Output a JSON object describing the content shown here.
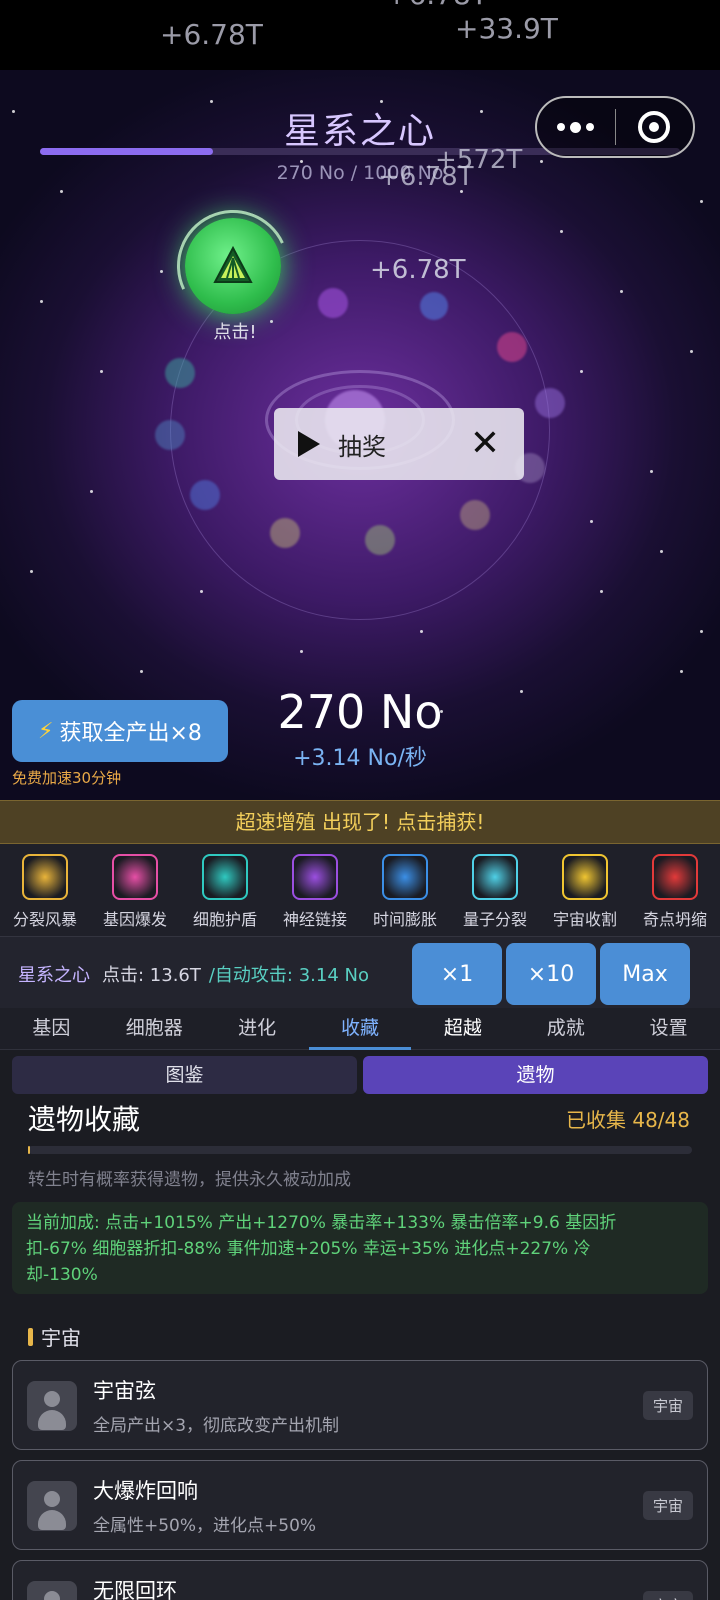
{
  "status_floats": [
    "+6.78T",
    "+33.9T",
    "+6.78T"
  ],
  "game": {
    "title": "星系之心",
    "progress_fraction": 0.27,
    "progress_text": "270 No / 1000 No",
    "floating_numbers": [
      "+572T",
      "+6.78T",
      "+6.78T"
    ],
    "click_label": "点击!",
    "lottery_label": "抽奖",
    "boost_label": "获取全产出×8",
    "boost_sub": "免费加速30分钟",
    "currency": "270 No",
    "rate": "+3.14 No/秒"
  },
  "event_banner": "超速增殖 出现了! 点击捕获!",
  "skills": [
    {
      "label": "分裂风暴",
      "icon": "split-storm-icon",
      "color": "#e9b43a"
    },
    {
      "label": "基因爆发",
      "icon": "gene-burst-icon",
      "color": "#e64fa6"
    },
    {
      "label": "细胞护盾",
      "icon": "cell-shield-icon",
      "color": "#2fc9c0"
    },
    {
      "label": "神经链接",
      "icon": "neural-link-icon",
      "color": "#9b4fe0"
    },
    {
      "label": "时间膨胀",
      "icon": "time-dilation-icon",
      "color": "#3b8fe6"
    },
    {
      "label": "量子分裂",
      "icon": "quantum-split-icon",
      "color": "#4fd0e6"
    },
    {
      "label": "宇宙收割",
      "icon": "cosmic-harvest-icon",
      "color": "#f0c531"
    },
    {
      "label": "奇点坍缩",
      "icon": "singularity-collapse-icon",
      "color": "#e23a3a"
    }
  ],
  "stats": {
    "name": "星系之心",
    "click": "点击: 13.6T",
    "auto": "/自动攻击: 3.14 No",
    "mult_buttons": [
      "×1",
      "×10",
      "Max"
    ]
  },
  "tabs": [
    "基因",
    "细胞器",
    "进化",
    "收藏",
    "超越",
    "成就",
    "设置"
  ],
  "subtabs": [
    "图鉴",
    "遗物"
  ],
  "collection": {
    "title": "遗物收藏",
    "count": "已收集 48/48",
    "fill_fraction": 0.003,
    "desc": "转生时有概率获得遗物，提供永久被动加成",
    "bonus_lines": [
      "当前加成: 点击+1015%  产出+1270%  暴击率+133%  暴击倍率+9.6  基因折",
      "扣-67%  细胞器折扣-88%  事件加速+205%  幸运+35%  进化点+227%  冷",
      "却-130%"
    ],
    "category": "宇宙",
    "relics": [
      {
        "name": "宇宙弦",
        "desc": "全局产出×3，彻底改变产出机制",
        "tag": "宇宙"
      },
      {
        "name": "大爆炸回响",
        "desc": "全属性+50%，进化点+50%",
        "tag": "宇宙"
      },
      {
        "name": "无限回环",
        "desc": "",
        "tag": "宇宙"
      }
    ]
  }
}
